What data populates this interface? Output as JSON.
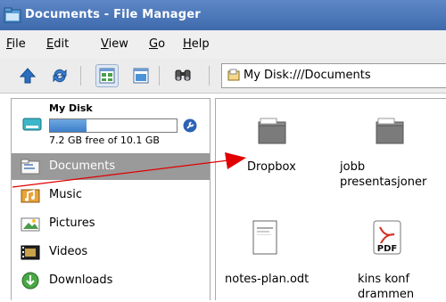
{
  "window": {
    "title": "Documents - File Manager"
  },
  "menu": {
    "items": [
      {
        "underline": "F",
        "rest": "ile"
      },
      {
        "underline": "E",
        "rest": "dit"
      },
      {
        "underline": "V",
        "rest": "iew"
      },
      {
        "underline": "G",
        "rest": "o"
      },
      {
        "underline": "H",
        "rest": "elp"
      }
    ]
  },
  "toolbar": {
    "location_text": "My Disk:///Documents",
    "icons": [
      "up-arrow-icon",
      "refresh-icon",
      "icon-view-icon",
      "detail-view-icon",
      "find-icon"
    ]
  },
  "sidebar": {
    "disk": {
      "name": "My Disk",
      "free_text": "7.2 GB free of 10.1 GB",
      "used_fraction": 0.29
    },
    "places": [
      {
        "label": "Documents",
        "icon": "documents-folder-icon",
        "selected": true
      },
      {
        "label": "Music",
        "icon": "music-folder-icon",
        "selected": false
      },
      {
        "label": "Pictures",
        "icon": "pictures-folder-icon",
        "selected": false
      },
      {
        "label": "Videos",
        "icon": "videos-folder-icon",
        "selected": false
      },
      {
        "label": "Downloads",
        "icon": "downloads-folder-icon",
        "selected": false
      }
    ]
  },
  "files": [
    {
      "name": "Dropbox",
      "type": "folder"
    },
    {
      "name": "jobb presentasjoner",
      "line1": "jobb",
      "line2": "presentasjoner",
      "type": "folder"
    },
    {
      "name": "notes-plan.odt",
      "type": "document"
    },
    {
      "name": "kins konf drammen",
      "line1": "kins konf",
      "line2": "drammen",
      "type": "pdf"
    }
  ],
  "colors": {
    "titlebar": "#4a76b8",
    "selection": "#9a9a9a",
    "arrow": "#e00000",
    "disk_bar": "#3d7fcc"
  }
}
